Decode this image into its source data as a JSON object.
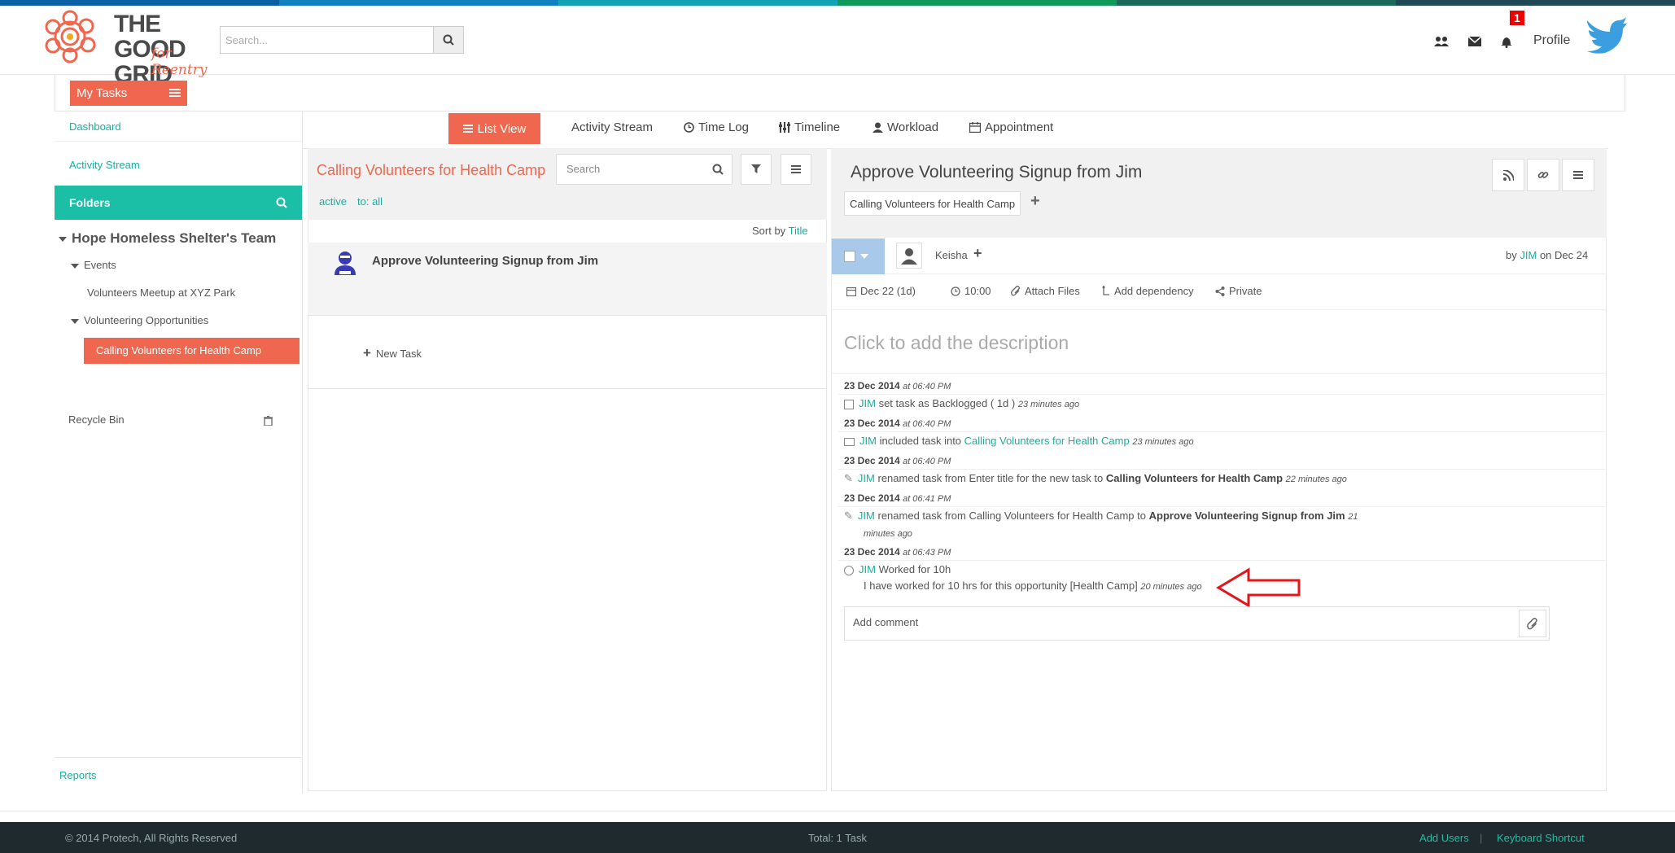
{
  "colors": {
    "accent": "#f0674f",
    "teal": "#1bbfa5",
    "link": "#1aad9f",
    "footer_bg": "#1f2a2e"
  },
  "header": {
    "logo_line1": "THE GOOD",
    "logo_line2": "GRID",
    "logo_sub": "for Reentry",
    "search_placeholder": "Search...",
    "profile_label": "Profile",
    "notification_count": "1",
    "icons": [
      "users-icon",
      "envelope-icon",
      "bell-icon",
      "twitter-icon"
    ]
  },
  "sidebar": {
    "my_tasks_label": "My Tasks",
    "dashboard_label": "Dashboard",
    "activity_stream_label": "Activity Stream",
    "folders_label": "Folders",
    "team_name": "Hope Homeless Shelter's Team",
    "events_label": "Events",
    "event_item": "Volunteers Meetup at XYZ Park",
    "volunteering_label": "Volunteering Opportunities",
    "active_folder": "Calling Volunteers for Health Camp",
    "recycle_bin_label": "Recycle Bin",
    "reports_label": "Reports"
  },
  "toolbar": {
    "tabs": [
      "List View",
      "Activity Stream",
      "Time Log",
      "Timeline",
      "Workload",
      "Appointment"
    ]
  },
  "list": {
    "title": "Calling Volunteers for Health Camp",
    "search_placeholder": "Search",
    "filter_active": "active",
    "filter_to": "to: all",
    "sort_by_label": "Sort by",
    "sort_by_value": "Title",
    "task_name": "Approve Volunteering Signup from Jim",
    "new_task_label": "New Task"
  },
  "detail": {
    "title": "Approve Volunteering Signup from Jim",
    "folder_crumb": "Calling Volunteers for Health Camp",
    "assignee": "Keisha",
    "by_label": "by",
    "by_user": "JIM",
    "on_date": "on Dec 24",
    "due_date": "Dec 22 (1d)",
    "time": "10:00",
    "attach_label": "Attach Files",
    "dependency_label": "Add dependency",
    "private_label": "Private",
    "description_placeholder": "Click to add the description",
    "comment_placeholder": "Add comment",
    "activities": [
      {
        "date": "23 Dec 2014",
        "time": "at 06:40 PM",
        "user": "JIM",
        "text": "set task as Backlogged ( 1d )",
        "ago": "23 minutes ago"
      },
      {
        "date": "23 Dec 2014",
        "time": "at 06:40 PM",
        "user": "JIM",
        "text": "included task into",
        "link": "Calling Volunteers for Health Camp",
        "ago": "23 minutes ago"
      },
      {
        "date": "23 Dec 2014",
        "time": "at 06:40 PM",
        "user": "JIM",
        "text": "renamed task from Enter title for the new task to",
        "bold": "Calling Volunteers for Health Camp",
        "ago": "22 minutes ago"
      },
      {
        "date": "23 Dec 2014",
        "time": "at 06:41 PM",
        "user": "JIM",
        "text": "renamed task from Calling Volunteers for Health Camp to",
        "bold": "Approve Volunteering Signup from Jim",
        "ago": "21 minutes ago"
      },
      {
        "date": "23 Dec 2014",
        "time": "at 06:43 PM",
        "user": "JIM",
        "text": "Worked for 10h",
        "note": "I have worked for 10 hrs for this opportunity [Health Camp]",
        "ago": "20 minutes ago"
      }
    ]
  },
  "footer": {
    "copyright": "© 2014 Protech, All Rights Reserved",
    "total": "Total: 1 Task",
    "add_users": "Add Users",
    "separator": "|",
    "keyboard": "Keyboard Shortcut"
  }
}
